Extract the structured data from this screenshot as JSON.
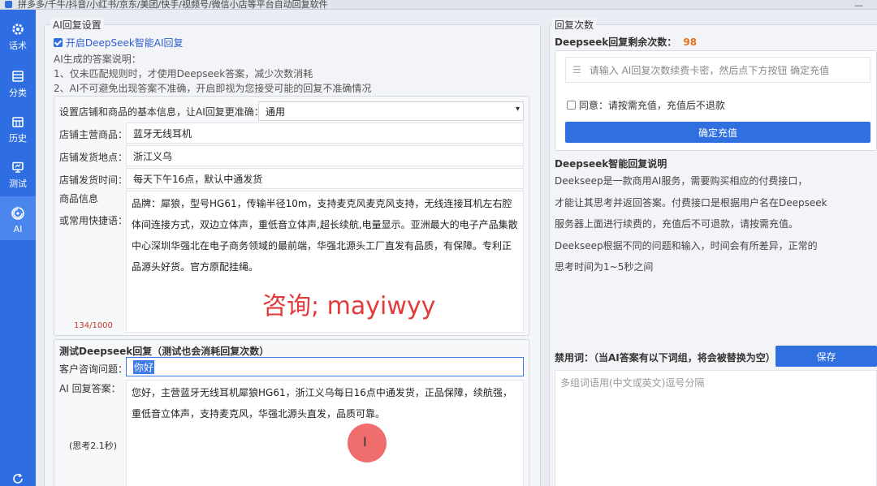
{
  "window": {
    "title": "拼多多/千牛/抖音/小红书/京东/美团/快手/视频号/微信小店等平台自动回复软件"
  },
  "sidebar": {
    "items": [
      {
        "label": "话术",
        "icon": "gear-icon"
      },
      {
        "label": "分类",
        "icon": "list-icon"
      },
      {
        "label": "历史",
        "icon": "calendar-icon"
      },
      {
        "label": "测试",
        "icon": "monitor-icon"
      },
      {
        "label": "AI",
        "icon": "ai-icon"
      }
    ],
    "active_index": 4
  },
  "ai_settings": {
    "group_title": "AI回复设置",
    "enable_label": "开启DeepSeek智能AI回复",
    "enable_checked": true,
    "note_title": "AI生成的答案说明：",
    "note_1": "1、仅未匹配规则时，才使用Deepseek答案，减少次数消耗",
    "note_2": "2、AI不可避免出现答案不准确，开启即视为您接受可能的回复不准确情况",
    "base_info_label": "设置店铺和商品的基本信息，让AI回复更准确：",
    "category_value": "通用",
    "main_product_label": "店铺主营商品：",
    "main_product_value": "蓝牙无线耳机",
    "ship_from_label": "店铺发货地点：",
    "ship_from_value": "浙江义乌",
    "ship_time_label": "店铺发货时间：",
    "ship_time_value": "每天下午16点，默认中通发货",
    "product_info_label_1": "商品信息",
    "product_info_label_2": "或常用快捷语：",
    "product_info_value": "品牌：犀狼，型号HG61，传输半径10m，支持麦克风麦克风支持，无线连接耳机左右腔体间连接方式，双边立体声，重低音立体声,超长续航,电量显示。亚洲最大的电子产品集散中心深圳华强北在电子商务领域的最前端，华强北源头工厂直发有品质，有保障。专利正品源头好货。官方原配挂绳。",
    "char_count": "134/1000"
  },
  "test_reply": {
    "title": "测试Deepseek回复（测试也会消耗回复次数）",
    "question_label": "客户咨询问题：",
    "question_value": "你好",
    "answer_label": "AI 回复答案：",
    "answer_value": "您好，主营蓝牙无线耳机犀狼HG61，浙江义乌每日16点中通发货，正品保障，续航强，重低音立体声，支持麦克风，华强北源头直发，品质可靠。",
    "think_time": "(思考2.1秒)"
  },
  "reply_count": {
    "group_title": "回复次数",
    "remaining_label": "Deepseek回复剩余次数：",
    "remaining_value": "98",
    "card_placeholder": "请输入 AI回复次数续费卡密，然后点下方按钮 确定充值",
    "agree_label": "同意：请按需充值，充值后不退款",
    "agree_checked": false,
    "recharge_button": "确定充值"
  },
  "description": {
    "title": "Deepseek智能回复说明",
    "lines": [
      "Deekseep是一款商用AI服务，需要购买相应的付费接口，",
      "才能让其思考并返回答案。付费接口是根据用户名在Deepseek",
      "服务器上面进行续费的，充值后不可退款，请按需充值。",
      "Deekseep根据不同的问题和输入，时间会有所差异，正常的",
      "思考时间为1~5秒之间"
    ]
  },
  "banned": {
    "label": "禁用词：（当AI答案有以下词组，将会被替换为空）",
    "save_button": "保存",
    "placeholder": "多组词语用(中文或英文)逗号分隔"
  },
  "overlay": {
    "watermark": "咨询; mayiwyy"
  },
  "colors": {
    "sidebar": "#2e6ee2",
    "primary": "#2f6fe0",
    "remaining": "#e8701a",
    "watermark": "#e23b3b"
  }
}
